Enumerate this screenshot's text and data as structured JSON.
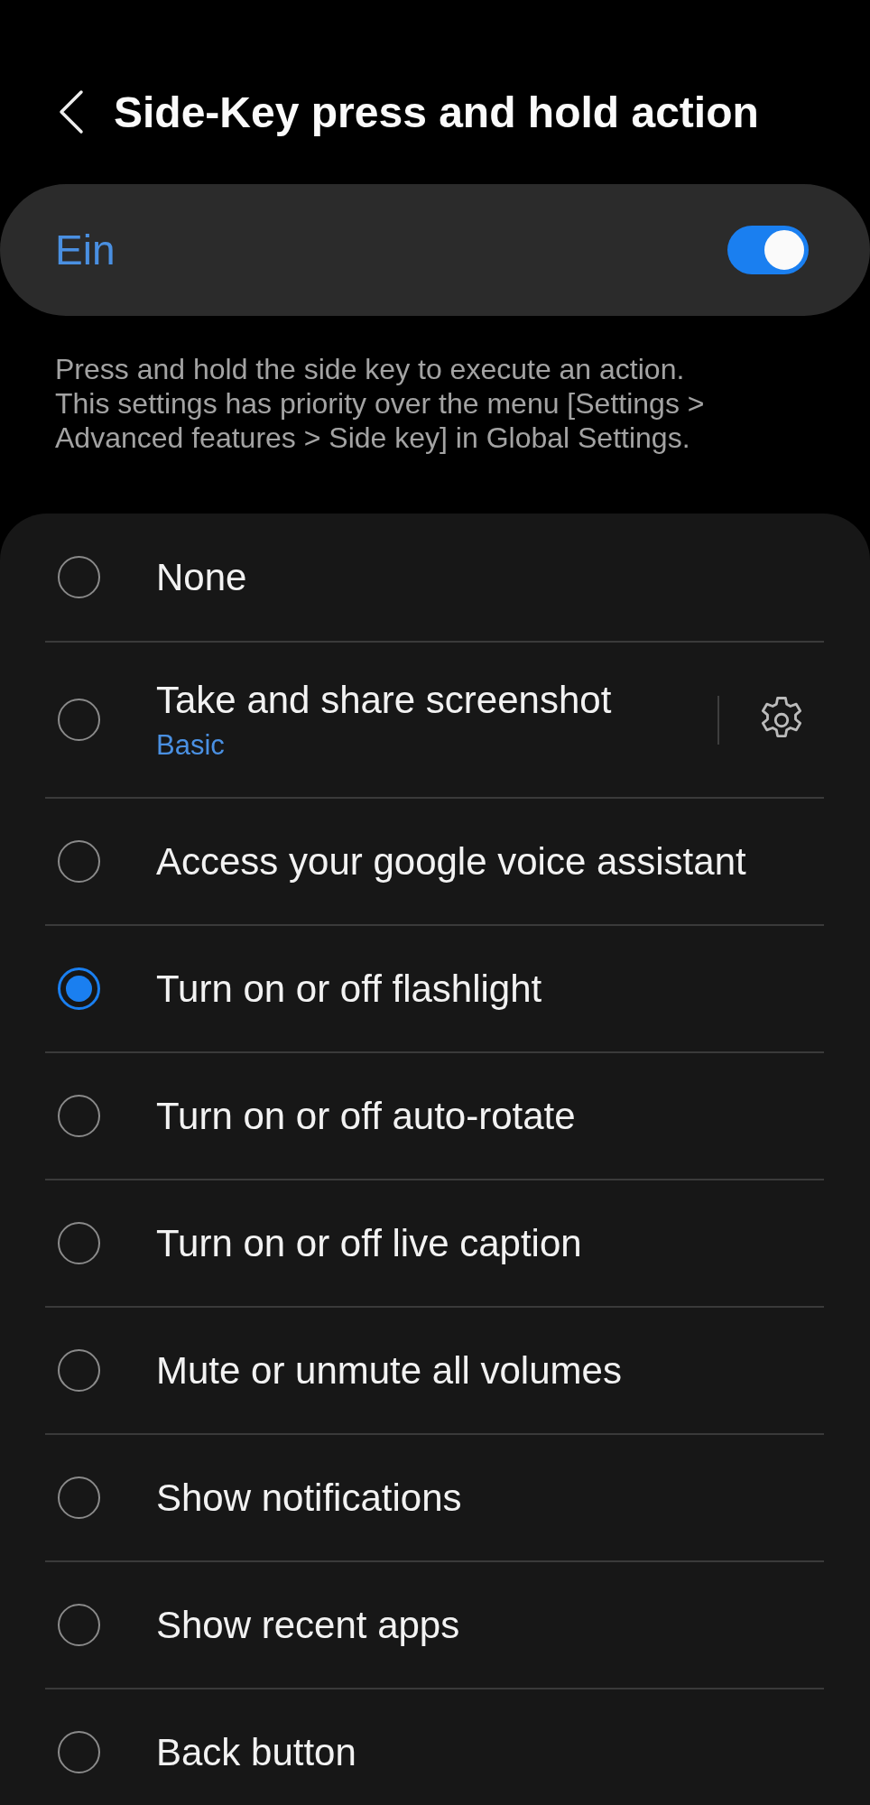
{
  "header": {
    "title": "Side-Key press and hold action"
  },
  "master_switch": {
    "label": "Ein",
    "on": true
  },
  "description": "Press and hold the side key to execute an action.\nThis settings has priority over the menu [Settings >\nAdvanced features > Side key] in Global Settings.",
  "options": [
    {
      "label": "None",
      "selected": false
    },
    {
      "label": "Take and share screenshot",
      "subtitle": "Basic",
      "selected": false,
      "has_settings": true
    },
    {
      "label": "Access your google voice assistant",
      "selected": false
    },
    {
      "label": "Turn on or off flashlight",
      "selected": true
    },
    {
      "label": "Turn on or off auto-rotate",
      "selected": false
    },
    {
      "label": "Turn on or off live caption",
      "selected": false
    },
    {
      "label": "Mute or unmute all volumes",
      "selected": false
    },
    {
      "label": "Show notifications",
      "selected": false
    },
    {
      "label": "Show recent apps",
      "selected": false
    },
    {
      "label": "Back button",
      "selected": false
    }
  ]
}
